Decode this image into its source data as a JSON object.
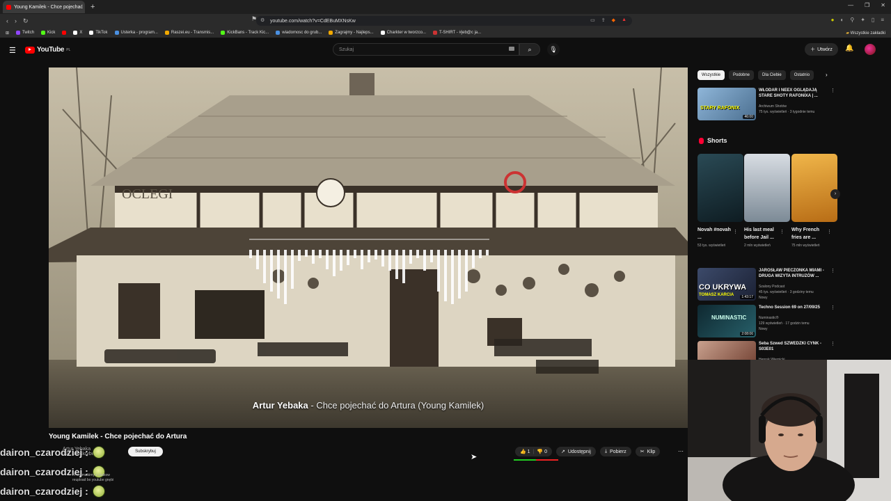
{
  "browser": {
    "tab_title": "Young Kamilek - Chce pojechać",
    "new_tab": "+",
    "url": "youtube.com/watch?v=CdEBuMXNsKw",
    "bookmarks": [
      {
        "label": "Twitch",
        "color": "#9146ff"
      },
      {
        "label": "Kick",
        "color": "#53fc18"
      },
      {
        "label": "",
        "color": "#ff0000"
      },
      {
        "label": "X",
        "color": "#ffffff"
      },
      {
        "label": "TikTok",
        "color": "#ffffff"
      },
      {
        "label": "Usterka - program...",
        "color": "#4a90e2"
      },
      {
        "label": "Raszei.eu - Transmis...",
        "color": "#f2a900"
      },
      {
        "label": "KickBans - Track Kic...",
        "color": "#53fc18"
      },
      {
        "label": "wiadomosc do grub...",
        "color": "#4a90e2"
      },
      {
        "label": "Zagrajmy - Najleps...",
        "color": "#f2a900"
      },
      {
        "label": "Charkter w tworzco...",
        "color": "#ffffff"
      },
      {
        "label": "T-SHIRT - #jeb@c ja...",
        "color": "#cc3333"
      }
    ],
    "all_bookmarks": "Wszystkie zakładki"
  },
  "youtube": {
    "logo_text": "YouTube",
    "region": "PL",
    "search_placeholder": "Szukaj",
    "create_label": "Utwórz"
  },
  "player": {
    "song_artist": "Artur Yebaka",
    "song_rest": " - Chce pojechać do Artura (Young Kamilek)",
    "sign_text": "OCLEGI"
  },
  "video": {
    "title": "Young Kamilek - Chce pojechać do Artura",
    "channel": "Artur Yebaka",
    "subscribers": "327 subskrybentów",
    "subscribe_label": "Subskrybuj",
    "likes": "1",
    "dislikes": "0",
    "share_label": "Udostępnij",
    "download_label": "Pobierz",
    "clip_label": "Klip"
  },
  "chat": {
    "messages": [
      {
        "user": "dairon_czarodziej :"
      },
      {
        "user": "dairon_czarodziej :"
      },
      {
        "user": "dairon_czarodziej :"
      }
    ],
    "overlay_text": [
      "Fr wytmaliśmy z siatkow",
      "reupload bo youtube gnębi"
    ]
  },
  "sidebar": {
    "chips": [
      "Wszystkie",
      "Podobne",
      "Dla Ciebie",
      "Ostatnio"
    ],
    "top_video": {
      "title": "WŁODAR I NEEX OGLĄDAJĄ STARE SHOTY RAFONIXA | ...",
      "channel": "Archiwum Shotów",
      "meta": "75 tys. wyświetleń · 3 tygodnie temu",
      "thumb_text": "STARY RAFONIX",
      "duration": "46:00"
    },
    "shorts_title": "Shorts",
    "shorts": [
      {
        "title": "Novah #novah ...",
        "views": "53 tys. wyświetleń"
      },
      {
        "title": "His last meal before Jail ...",
        "views": "2 mln wyświetleń"
      },
      {
        "title": "Why French fries are ...",
        "views": "75 mln wyświetleń"
      }
    ],
    "videos": [
      {
        "title": "JAROSŁAW PIECZONKA MIAMI - DRUGA WIZYTA INTRUZÓW ...",
        "channel": "Szalony Podcast",
        "meta": "45 tys. wyświetleń · 3 godziny temu",
        "badge": "Nowy",
        "thumb_text": "CO UKRYWA",
        "thumb_sub": "TOMASZ KARCIA",
        "duration": "1:43:17"
      },
      {
        "title": "Techno Session 69 on 27/09/25",
        "channel": "Numinastic®",
        "meta": "129 wyświetleń · 17 godzin temu",
        "badge": "Nowy",
        "thumb_text": "NUMINASTIC",
        "duration": "2:08:06"
      },
      {
        "title": "Seba Szwed SZWEDZKI CYNK - S03E01",
        "channel": "Henryk Wiernicki",
        "meta": "",
        "badge": "",
        "thumb_text": "",
        "duration": ""
      }
    ]
  }
}
